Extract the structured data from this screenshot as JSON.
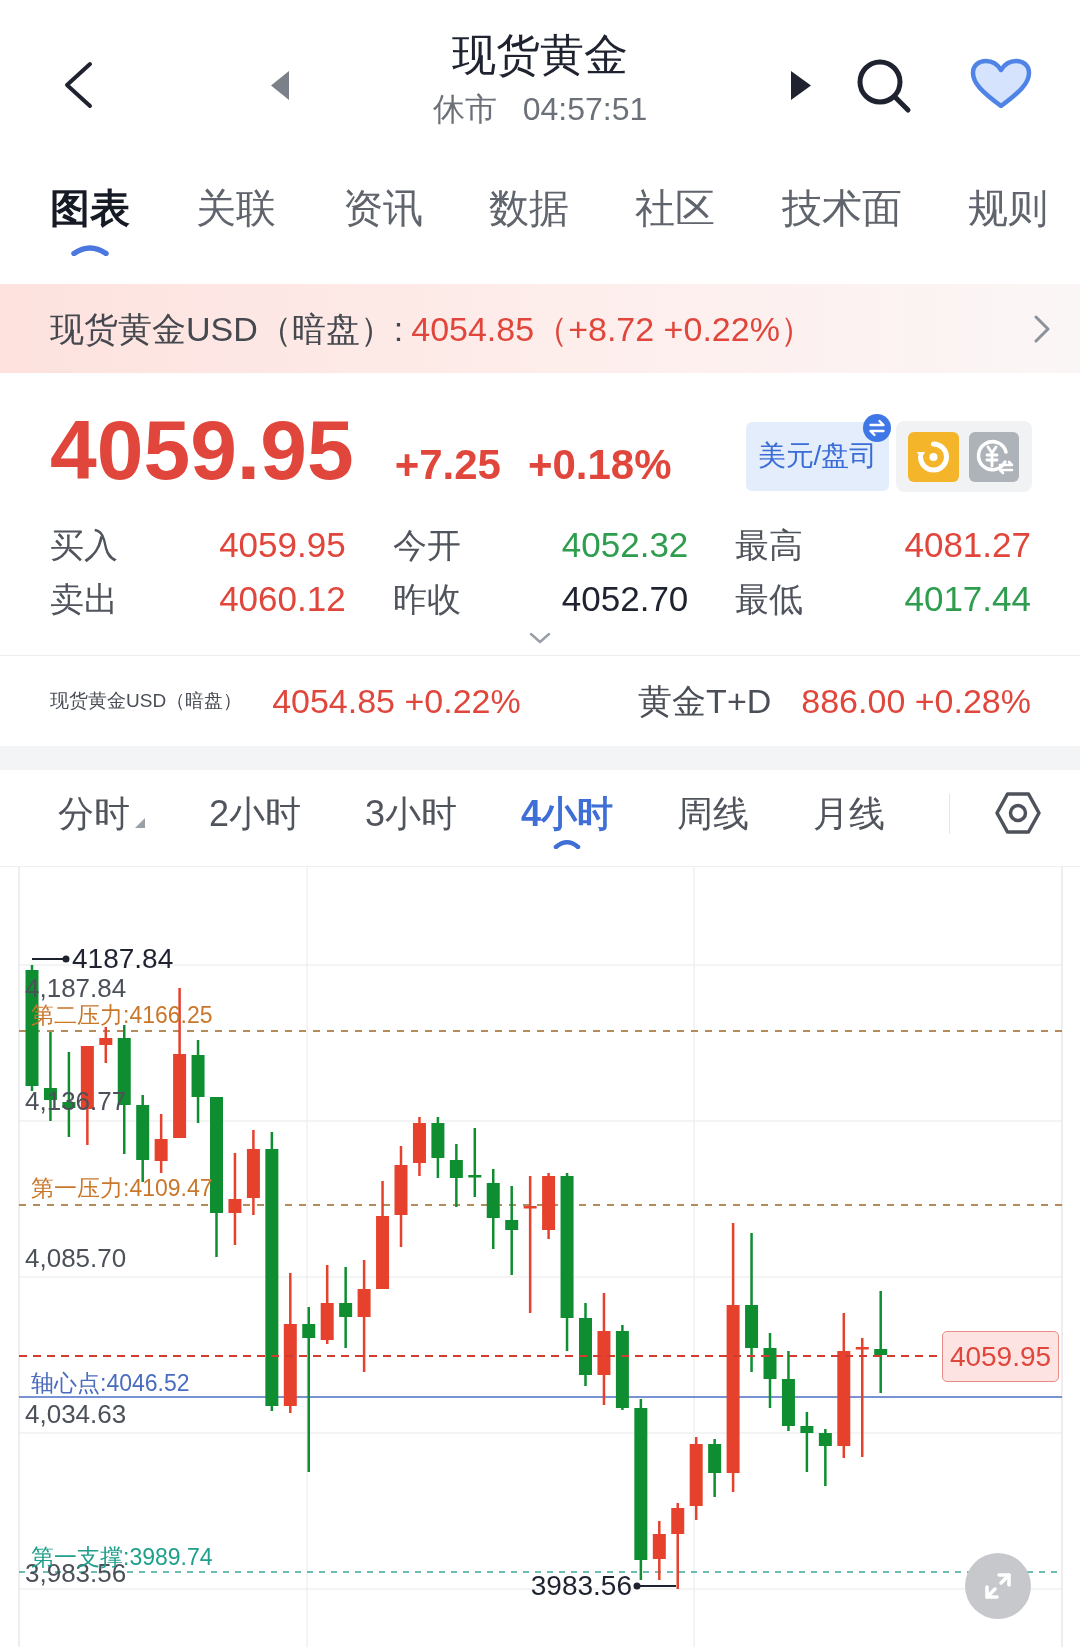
{
  "header": {
    "title": "现货黄金",
    "status": "休市",
    "time": "04:57:51"
  },
  "tabs": [
    {
      "label": "图表",
      "selected": true
    },
    {
      "label": "关联",
      "selected": false
    },
    {
      "label": "资讯",
      "selected": false
    },
    {
      "label": "数据",
      "selected": false
    },
    {
      "label": "社区",
      "selected": false
    },
    {
      "label": "技术面",
      "selected": false
    },
    {
      "label": "规则",
      "selected": false
    }
  ],
  "banner": {
    "label": "现货黄金USD（暗盘）:",
    "value": "4054.85（+8.72 +0.22%）"
  },
  "quote": {
    "price": "4059.95",
    "change": "+7.25",
    "change_percent": "+0.18%",
    "currency": "美元/盘司"
  },
  "stats": [
    {
      "label": "买入",
      "value": "4059.95",
      "color": "#e0463b"
    },
    {
      "label": "今开",
      "value": "4052.32",
      "color": "#2e9d4e"
    },
    {
      "label": "最高",
      "value": "4081.27",
      "color": "#e0463b"
    },
    {
      "label": "卖出",
      "value": "4060.12",
      "color": "#e0463b"
    },
    {
      "label": "昨收",
      "value": "4052.70",
      "color": "#1f2330"
    },
    {
      "label": "最低",
      "value": "4017.44",
      "color": "#2e9d4e"
    }
  ],
  "related": [
    {
      "name": "现货黄金USD（暗盘）",
      "value": "4054.85 +0.22%",
      "kind": "compact",
      "color": "#e0463b"
    },
    {
      "name": "黄金T+D",
      "value": "886.00 +0.28%",
      "kind": "regular",
      "color": "#e0463b"
    }
  ],
  "periods": [
    {
      "label": "分时",
      "selected": false,
      "dropdown": true
    },
    {
      "label": "2小时",
      "selected": false,
      "dropdown": false
    },
    {
      "label": "3小时",
      "selected": false,
      "dropdown": false
    },
    {
      "label": "4小时",
      "selected": true,
      "dropdown": false
    },
    {
      "label": "周线",
      "selected": false,
      "dropdown": false
    },
    {
      "label": "月线",
      "selected": false,
      "dropdown": false
    }
  ],
  "chart": {
    "high_label": "4187.84",
    "y_labels": [
      "4,187.84",
      "4,136.77",
      "4,085.70",
      "4,034.63",
      "3,983.56"
    ],
    "levels": [
      {
        "label": "第二压力:4166.25",
        "kind": "resistance"
      },
      {
        "label": "第一压力:4109.47",
        "kind": "resistance"
      },
      {
        "label": "轴心点:4046.52",
        "kind": "pivot"
      },
      {
        "label": "第一支撑:3989.74",
        "kind": "support"
      }
    ],
    "last_price": "4059.95",
    "low_label": "3983.56"
  }
}
